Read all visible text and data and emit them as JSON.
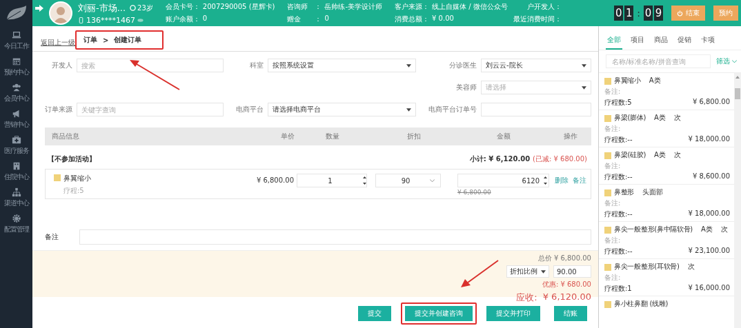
{
  "sidebar": {
    "items": [
      {
        "label": "今日工作",
        "kind": "laptop"
      },
      {
        "label": "预约中心",
        "kind": "calendar"
      },
      {
        "label": "会员中心",
        "kind": "users"
      },
      {
        "label": "营销中心",
        "kind": "megaphone"
      },
      {
        "label": "医疗服务",
        "kind": "medkit"
      },
      {
        "label": "住院中心",
        "kind": "building"
      },
      {
        "label": "渠道中心",
        "kind": "sitemap"
      },
      {
        "label": "配置管理",
        "kind": "gear"
      }
    ]
  },
  "header": {
    "customer": {
      "name": "刘丽-市场...",
      "phone": "136****1467",
      "age": "23岁"
    },
    "info_columns": [
      [
        {
          "label": "会员卡号：",
          "value": "2007290005 (星辉卡)"
        },
        {
          "label": "账户余额：",
          "value": "0"
        }
      ],
      [
        {
          "label": "咨询师　：",
          "value": "岳帅练-美学设计师"
        },
        {
          "label": "赠金　　：",
          "value": "0"
        }
      ],
      [
        {
          "label": "客户来源：",
          "value": "线上自媒体 / 微信公众号"
        },
        {
          "label": "消费总额：",
          "value": "¥ 0.00"
        }
      ],
      [
        {
          "label": "户开发人："
        },
        {
          "label": "最近消费时间："
        }
      ]
    ],
    "timer": {
      "hours": [
        "0",
        "1"
      ],
      "separator": ":",
      "minutes": [
        "0",
        "9"
      ]
    },
    "buttons": [
      {
        "label": "结束",
        "kind": "power"
      },
      {
        "label": "预约",
        "kind": "plain"
      }
    ]
  },
  "breadcrumb": {
    "back": "返回上一级",
    "items": [
      "订单",
      "创建订单"
    ],
    "separator": ">",
    "highlighted": true
  },
  "form": {
    "rows": [
      [
        {
          "label": "开发人",
          "kind": "input",
          "placeholder": "搜索"
        },
        {
          "label": "科室",
          "kind": "select",
          "value": "按照系统设置"
        },
        {
          "label": "分诊医生",
          "kind": "select",
          "value": "刘云云-院长"
        }
      ],
      [
        {
          "kind": "blank"
        },
        {
          "kind": "blank"
        },
        {
          "label": "美容师",
          "kind": "select",
          "placeholder": "请选择"
        }
      ],
      [
        {
          "label": "订单来源",
          "kind": "input",
          "placeholder": "关键字查询"
        },
        {
          "label": "电商平台",
          "kind": "select",
          "value": "请选择电商平台"
        },
        {
          "label": "电商平台订单号",
          "kind": "input"
        }
      ]
    ]
  },
  "table": {
    "columns": [
      "商品信息",
      "单价",
      "数量",
      "折扣",
      "金额",
      "操作"
    ],
    "group": {
      "title": "【不参加活动】",
      "subtotal": "小计: ¥ 6,120.00",
      "reduced": "(已减: ¥ 680.00)"
    },
    "rows": [
      {
        "name": "鼻翼缩小",
        "course": "疗程:5",
        "price": "¥ 6,800.00",
        "quantity": "1",
        "discount": "90",
        "amount": "6120",
        "original": "¥ 6,800.00",
        "actions": [
          "删除",
          "备注"
        ]
      }
    ]
  },
  "remarks": {
    "label": "备注"
  },
  "summary": {
    "total": "总价 ¥ 6,800.00",
    "discount_mode": "折扣比例",
    "discount_value": "90.00",
    "saving": "优惠: ¥ 680.00",
    "due_label": "应收:",
    "due": "¥ 6,120.00"
  },
  "actions": [
    {
      "label": "提交",
      "highlighted": false
    },
    {
      "label": "提交并创建咨询",
      "highlighted": true
    },
    {
      "label": "提交并打印",
      "highlighted": false
    },
    {
      "label": "结账",
      "highlighted": false
    }
  ],
  "catalog": {
    "tabs": [
      {
        "label": "全部",
        "selected": true
      },
      {
        "label": "项目",
        "selected": false
      },
      {
        "label": "商品",
        "selected": false
      },
      {
        "label": "促销",
        "selected": false
      },
      {
        "label": "卡项",
        "selected": false
      }
    ],
    "search": {
      "placeholder": "名称/标准名称/拼音查询"
    },
    "filter": "筛选",
    "items": [
      {
        "name": "鼻翼缩小",
        "tags": [
          "A类"
        ],
        "note": "备注:",
        "course": "疗程数:5",
        "price": "¥ 6,800.00"
      },
      {
        "name": "鼻梁(膨体)",
        "tags": [
          "A类",
          "次"
        ],
        "note": "备注:",
        "course": "疗程数:--",
        "price": "¥ 18,000.00"
      },
      {
        "name": "鼻梁(硅胶)",
        "tags": [
          "A类",
          "次"
        ],
        "note": "备注:",
        "course": "疗程数:--",
        "price": "¥ 8,600.00"
      },
      {
        "name": "鼻整形",
        "tags": [
          "头面部"
        ],
        "note": "备注:",
        "course": "疗程数:--",
        "price": "¥ 18,000.00"
      },
      {
        "name": "鼻尖一般整形(鼻中隔软骨)",
        "tags": [
          "A类",
          "次"
        ],
        "note": "备注:",
        "course": "疗程数:--",
        "price": "¥ 23,100.00"
      },
      {
        "name": "鼻尖一般整形(耳软骨)",
        "tags": [
          "次"
        ],
        "note": "备注:",
        "course": "疗程数:1",
        "price": "¥ 16,000.00"
      },
      {
        "name": "鼻小柱鼻翻 (线雕)"
      }
    ]
  }
}
